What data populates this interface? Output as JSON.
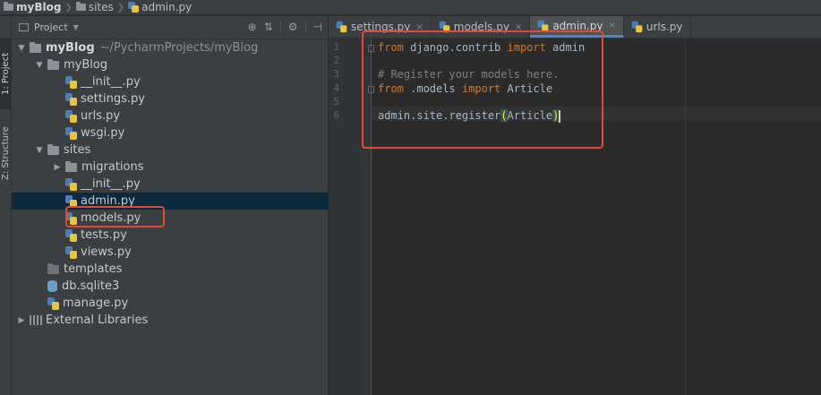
{
  "breadcrumb": [
    {
      "label": "myBlog",
      "icon": "folder-icon"
    },
    {
      "label": "sites",
      "icon": "folder-icon"
    },
    {
      "label": "admin.py",
      "icon": "python-file-icon"
    }
  ],
  "toolstrip": {
    "project_tab": "1: Project",
    "structure_tab": "Z: Structure"
  },
  "panel": {
    "title": "Project",
    "tools": [
      "⊕",
      "⇅",
      "⚙",
      "⊣"
    ]
  },
  "tree": [
    {
      "label": "myBlog",
      "hint": "~/PycharmProjects/myBlog",
      "depth": 0,
      "arrow": "▼",
      "type": "folder",
      "bold": true
    },
    {
      "label": "myBlog",
      "depth": 1,
      "arrow": "▼",
      "type": "folder"
    },
    {
      "label": "__init__.py",
      "depth": 2,
      "type": "python"
    },
    {
      "label": "settings.py",
      "depth": 2,
      "type": "python"
    },
    {
      "label": "urls.py",
      "depth": 2,
      "type": "python"
    },
    {
      "label": "wsgi.py",
      "depth": 2,
      "type": "python"
    },
    {
      "label": "sites",
      "depth": 1,
      "arrow": "▼",
      "type": "folder"
    },
    {
      "label": "migrations",
      "depth": 2,
      "arrow": "▶",
      "type": "folder"
    },
    {
      "label": "__init__.py",
      "depth": 2,
      "type": "python"
    },
    {
      "label": "admin.py",
      "depth": 2,
      "type": "python",
      "selected": true
    },
    {
      "label": "models.py",
      "depth": 2,
      "type": "python"
    },
    {
      "label": "tests.py",
      "depth": 2,
      "type": "python"
    },
    {
      "label": "views.py",
      "depth": 2,
      "type": "python"
    },
    {
      "label": "templates",
      "depth": 1,
      "type": "folder-dark"
    },
    {
      "label": "db.sqlite3",
      "depth": 1,
      "type": "database"
    },
    {
      "label": "manage.py",
      "depth": 1,
      "type": "python"
    },
    {
      "label": "External Libraries",
      "depth": 0,
      "arrow": "▶",
      "type": "library"
    }
  ],
  "tabs": [
    {
      "label": "settings.py",
      "active": false
    },
    {
      "label": "models.py",
      "active": false
    },
    {
      "label": "admin.py",
      "active": true
    },
    {
      "label": "urls.py",
      "active": false,
      "no_close": true
    }
  ],
  "editor": {
    "line_numbers": [
      "1",
      "2",
      "3",
      "4",
      "5",
      "6"
    ],
    "lines": [
      {
        "parts": [
          {
            "t": "from",
            "c": "kw"
          },
          {
            "t": " django.contrib ",
            "c": ""
          },
          {
            "t": "import",
            "c": "kw"
          },
          {
            "t": " admin",
            "c": ""
          }
        ],
        "fold": true
      },
      {
        "parts": []
      },
      {
        "parts": [
          {
            "t": "# Register your models here.",
            "c": "cm"
          }
        ]
      },
      {
        "parts": [
          {
            "t": "from",
            "c": "kw"
          },
          {
            "t": " .models ",
            "c": ""
          },
          {
            "t": "import",
            "c": "kw"
          },
          {
            "t": " Article",
            "c": ""
          }
        ],
        "fold": true
      },
      {
        "parts": []
      },
      {
        "parts": [
          {
            "t": "admin.site.register",
            "c": ""
          },
          {
            "t": "(",
            "c": "paren"
          },
          {
            "t": "Article",
            "c": ""
          },
          {
            "t": ")",
            "c": "paren"
          }
        ],
        "caret": true
      }
    ]
  },
  "colors": {
    "accent_highlight": "#e04a3a",
    "keyword": "#cc7832",
    "comment": "#808080",
    "selection": "#0d293e"
  }
}
